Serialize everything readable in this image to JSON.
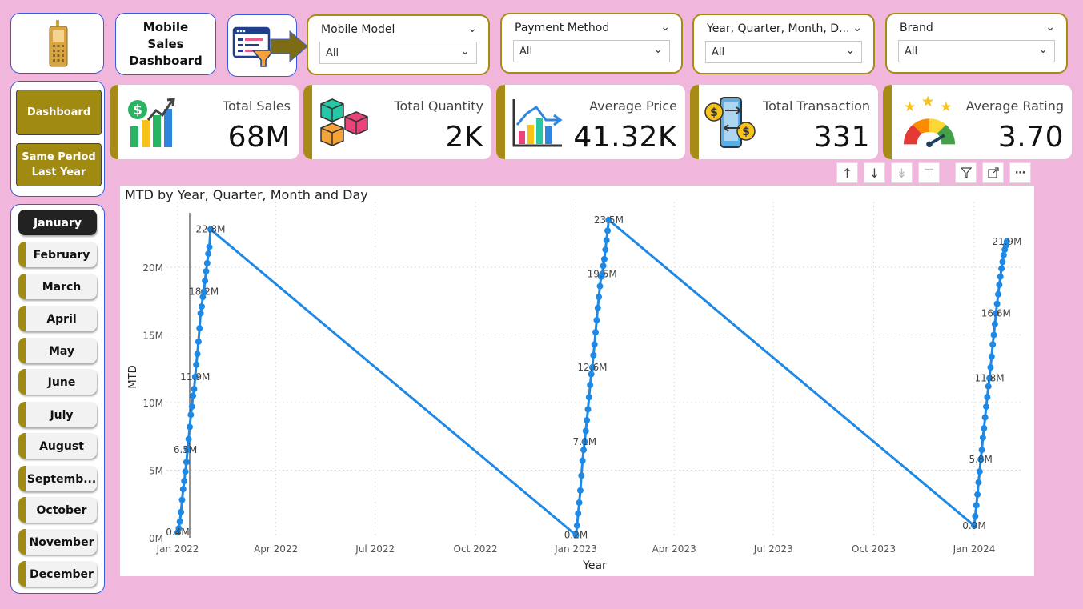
{
  "header": {
    "logo_icon": "mobile-phone-icon",
    "title": "Mobile Sales Dashboard",
    "filter_icon": "filter-report-icon"
  },
  "slicers": [
    {
      "title": "Mobile Model",
      "value": "All"
    },
    {
      "title": "Payment Method",
      "value": "All"
    },
    {
      "title": "Year, Quarter, Month, D...",
      "value": "All"
    },
    {
      "title": "Brand",
      "value": "All"
    }
  ],
  "nav": {
    "dashboard": "Dashboard",
    "same_period": "Same Period Last Year"
  },
  "months": [
    "January",
    "February",
    "March",
    "April",
    "May",
    "June",
    "July",
    "August",
    "Septemb...",
    "October",
    "November",
    "December"
  ],
  "active_month": "January",
  "kpis": [
    {
      "label": "Total Sales",
      "value": "68M",
      "icon": "dollar-bar-chart-icon"
    },
    {
      "label": "Total Quantity",
      "value": "2K",
      "icon": "boxes-icon"
    },
    {
      "label": "Average Price",
      "value": "41.32K",
      "icon": "price-chart-icon"
    },
    {
      "label": "Total Transaction",
      "value": "331",
      "icon": "phone-money-transfer-icon"
    },
    {
      "label": "Average Rating",
      "value": "3.70",
      "icon": "rating-gauge-icon"
    }
  ],
  "colors": {
    "background": "#f1b6dc",
    "accent_gold": "#a88a16",
    "series_blue": "#1e88e5"
  },
  "chart_data": {
    "type": "line",
    "title": "MTD by Year, Quarter, Month and Day",
    "xlabel": "Year",
    "ylabel": "MTD",
    "ylim": [
      0,
      23.5
    ],
    "y_ticks": [
      "0M",
      "5M",
      "10M",
      "15M",
      "20M"
    ],
    "x_ticks": [
      "Jan 2022",
      "Apr 2022",
      "Jul 2022",
      "Oct 2022",
      "Jan 2023",
      "Apr 2023",
      "Jul 2023",
      "Oct 2023",
      "Jan 2024"
    ],
    "grid": true,
    "series": [
      {
        "segments": [
          {
            "start": "2022-01-01",
            "end": "2022-01-31",
            "values": [
              0.4,
              0.7,
              1.2,
              1.9,
              2.8,
              3.6,
              4.2,
              4.9,
              5.6,
              6.5,
              7.3,
              8.2,
              9.1,
              9.7,
              10.5,
              11.0,
              11.9,
              12.8,
              13.6,
              14.5,
              15.5,
              16.6,
              17.1,
              17.8,
              18.2,
              19.0,
              19.7,
              20.3,
              21.0,
              21.5,
              22.8
            ]
          },
          {
            "start": "2023-01-01",
            "end": "2023-01-31",
            "values": [
              0.2,
              0.9,
              1.8,
              2.6,
              3.5,
              4.6,
              5.7,
              6.5,
              7.1,
              7.9,
              8.7,
              9.5,
              10.4,
              11.3,
              12.1,
              12.6,
              13.5,
              14.3,
              15.2,
              16.1,
              17.0,
              17.8,
              18.6,
              19.3,
              19.5,
              20.1,
              20.6,
              21.3,
              22.0,
              22.7,
              23.5
            ]
          },
          {
            "start": "2024-01-01",
            "end": "2024-01-31",
            "values": [
              0.9,
              1.6,
              2.4,
              3.2,
              4.1,
              4.9,
              5.8,
              6.5,
              7.4,
              8.1,
              8.9,
              9.7,
              10.4,
              11.2,
              11.8,
              12.6,
              13.4,
              14.3,
              15.0,
              15.8,
              16.6,
              17.3,
              18.0,
              18.7,
              19.3,
              19.9,
              20.4,
              20.9,
              21.3,
              21.6,
              21.9
            ]
          }
        ]
      }
    ],
    "data_labels": [
      {
        "x": "2022-01-01",
        "value": 0.4,
        "text": "0.4M"
      },
      {
        "x": "2022-01-08",
        "value": 6.5,
        "text": "6.5M"
      },
      {
        "x": "2022-01-17",
        "value": 11.9,
        "text": "11.9M"
      },
      {
        "x": "2022-01-25",
        "value": 18.2,
        "text": "18.2M"
      },
      {
        "x": "2022-01-31",
        "value": 22.8,
        "text": "22.8M"
      },
      {
        "x": "2023-01-01",
        "value": 0.2,
        "text": "0.2M"
      },
      {
        "x": "2023-01-09",
        "value": 7.1,
        "text": "7.1M"
      },
      {
        "x": "2023-01-16",
        "value": 12.6,
        "text": "12.6M"
      },
      {
        "x": "2023-01-25",
        "value": 19.5,
        "text": "19.5M"
      },
      {
        "x": "2023-01-31",
        "value": 23.5,
        "text": "23.5M"
      },
      {
        "x": "2024-01-01",
        "value": 0.9,
        "text": "0.9M"
      },
      {
        "x": "2024-01-07",
        "value": 5.8,
        "text": "5.8M"
      },
      {
        "x": "2024-01-15",
        "value": 11.8,
        "text": "11.8M"
      },
      {
        "x": "2024-01-21",
        "value": 16.6,
        "text": "16.6M"
      },
      {
        "x": "2024-01-31",
        "value": 21.9,
        "text": "21.9M"
      }
    ],
    "reference_line_x": "2022-01-12"
  }
}
